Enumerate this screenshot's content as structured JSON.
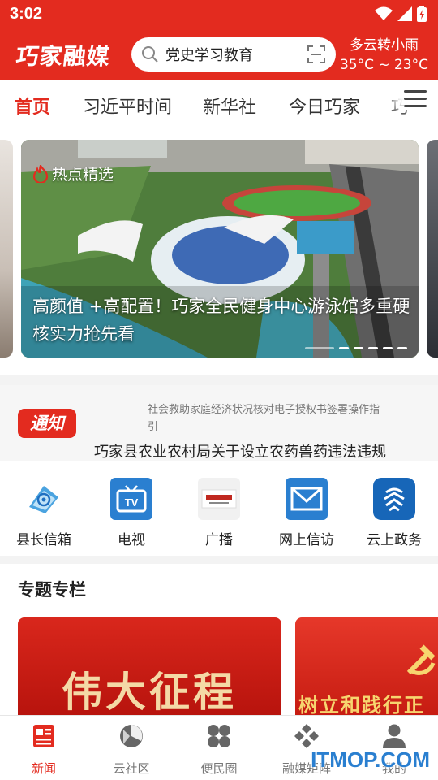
{
  "status_bar": {
    "time": "3:02"
  },
  "header": {
    "logo": "巧家融媒",
    "search_placeholder": "党史学习教育",
    "weather": {
      "condition": "多云转小雨",
      "temperature": "35°C ~ 23°C"
    }
  },
  "tabs": [
    {
      "label": "首页",
      "active": true
    },
    {
      "label": "习近平时间",
      "active": false
    },
    {
      "label": "新华社",
      "active": false
    },
    {
      "label": "今日巧家",
      "active": false
    },
    {
      "label": "巧",
      "active": false
    }
  ],
  "carousel": {
    "badge": "热点精选",
    "title": "高颜值 +高配置！巧家全民健身中心游泳馆多重硬核实力抢先看",
    "slide_count": 6,
    "active_index": 0
  },
  "notice": {
    "badge": "通知",
    "previous": "社会救助家庭经济状况核对电子授权书签署操作指引",
    "current": "巧家县农业农村局关于设立农药兽药违法违规"
  },
  "shortcuts": [
    {
      "label": "县长信箱",
      "icon": "email-at-icon"
    },
    {
      "label": "电视",
      "icon": "tv-icon"
    },
    {
      "label": "广播",
      "icon": "radio-fm-icon"
    },
    {
      "label": "网上信访",
      "icon": "envelope-icon"
    },
    {
      "label": "云上政务",
      "icon": "gov-service-icon"
    }
  ],
  "special_section": {
    "title": "专题专栏",
    "cards": [
      {
        "text": "伟大征程"
      },
      {
        "text": "树立和践行正"
      }
    ]
  },
  "bottom_nav": [
    {
      "label": "新闻",
      "icon": "news-icon",
      "active": true
    },
    {
      "label": "云社区",
      "icon": "community-icon",
      "active": false
    },
    {
      "label": "便民圈",
      "icon": "grid-circles-icon",
      "active": false
    },
    {
      "label": "融媒矩阵",
      "icon": "matrix-icon",
      "active": false
    },
    {
      "label": "我的",
      "icon": "user-icon",
      "active": false
    }
  ],
  "watermark": "ITMOP.COM",
  "colors": {
    "brand_red": "#e32b1f",
    "shortcut_blue": "#2a7fd0"
  }
}
